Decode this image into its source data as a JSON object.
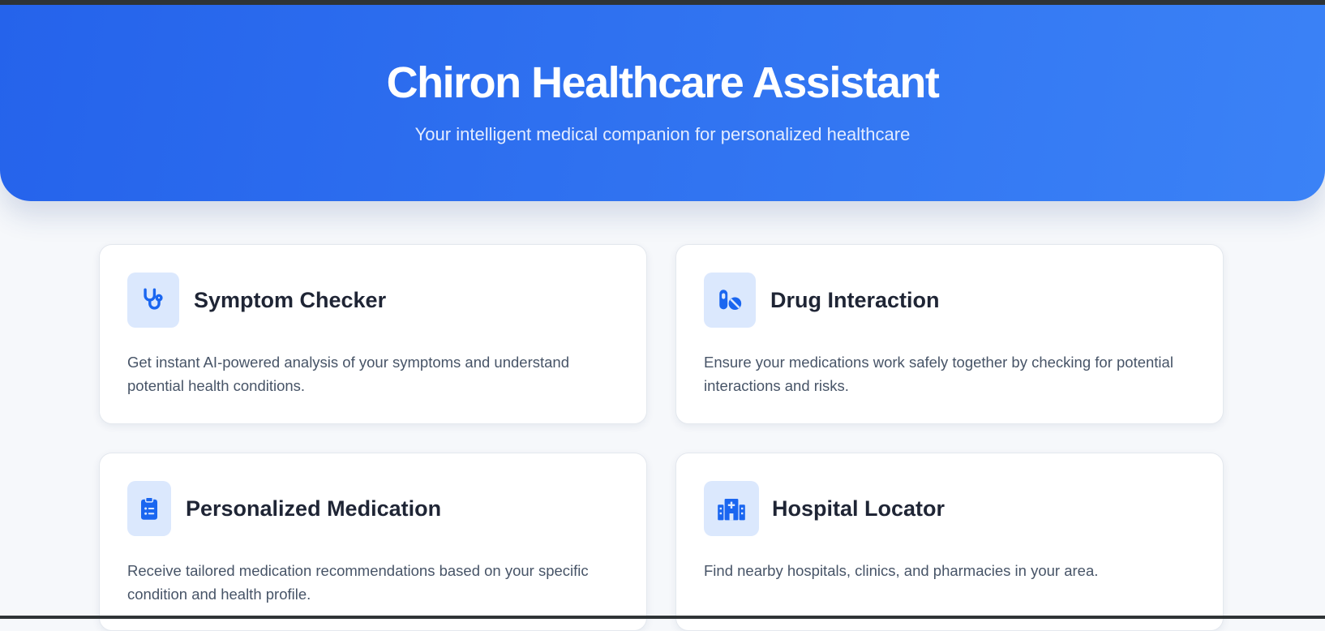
{
  "header": {
    "title": "Chiron Healthcare Assistant",
    "subtitle": "Your intelligent medical companion for personalized healthcare"
  },
  "cards": [
    {
      "title": "Symptom Checker",
      "icon": "stethoscope-icon",
      "description": "Get instant AI-powered analysis of your symptoms and understand potential health conditions."
    },
    {
      "title": "Drug Interaction",
      "icon": "pills-icon",
      "description": "Ensure your medications work safely together by checking for potential interactions and risks."
    },
    {
      "title": "Personalized Medication",
      "icon": "clipboard-list-icon",
      "description": "Receive tailored medication recommendations based on your specific condition and health profile."
    },
    {
      "title": "Hospital Locator",
      "icon": "hospital-icon",
      "description": "Find nearby hospitals, clinics, and pharmacies in your area."
    }
  ],
  "colors": {
    "accent": "#2563eb",
    "accent_light": "#3b82f6",
    "icon_bg": "#dbe8fd",
    "frame": "#2f3436"
  }
}
